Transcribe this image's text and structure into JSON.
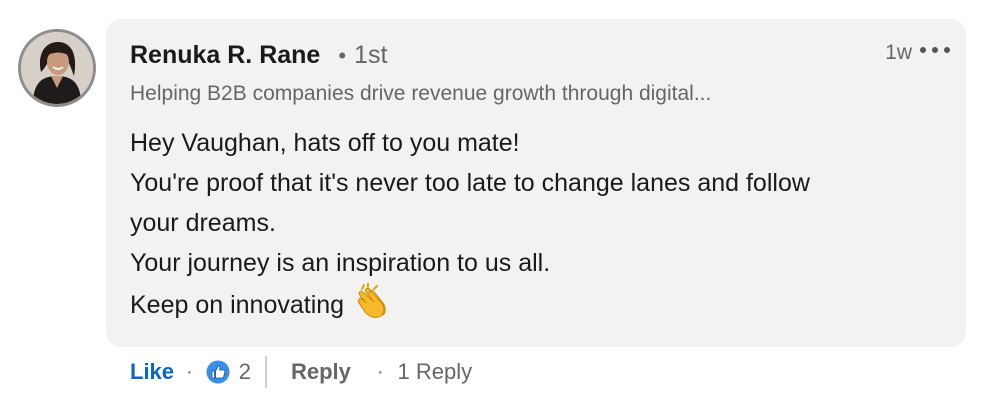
{
  "comment": {
    "author": {
      "name": "Renuka R. Rane",
      "connection_degree": "1st",
      "headline": "Helping B2B companies drive revenue growth through digital..."
    },
    "separator_dot": "•",
    "timestamp": "1w",
    "body_lines": [
      "Hey Vaughan, hats off to you mate!",
      "You're proof that it's never too late to change lanes and follow",
      "your dreams.",
      "Your journey is an inspiration to us all.",
      "Keep on innovating"
    ],
    "body_emoji": "clapping-hands-icon"
  },
  "actions": {
    "like_label": "Like",
    "separator_dot": "·",
    "reaction_icon": "like-thumbs-up-icon",
    "reaction_count": "2",
    "reply_label": "Reply",
    "replies_label": "1 Reply"
  },
  "colors": {
    "bubble_background": "#f2f2f2",
    "link_blue": "#0a66c2",
    "muted_text": "#666666",
    "primary_text": "#1a1a1a"
  }
}
